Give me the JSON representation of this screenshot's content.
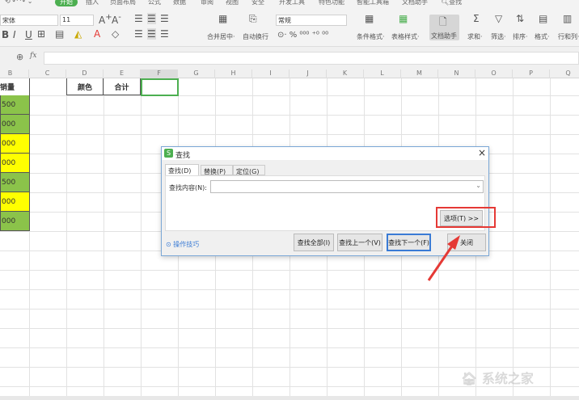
{
  "menu": {
    "items": [
      "",
      "开始",
      "插入",
      "页面布局",
      "公式",
      "数据",
      "审阅",
      "视图",
      "安全",
      "开发工具",
      "特色功能",
      "智能工具箱",
      "文档助手",
      "查找"
    ]
  },
  "ribbon": {
    "font_name": "宋体",
    "font_size": "11",
    "number_format": "常规",
    "merge": "合并居中·",
    "wrap": "自动换行",
    "cond_format": "条件格式·",
    "table_style": "表格样式·",
    "doc_helper": "文档助手",
    "sum": "求和·",
    "filter": "筛选·",
    "sort": "排序·",
    "format": "格式·",
    "rowcol": "行和列·"
  },
  "formula_bar": {
    "fx": "fx",
    "value": ""
  },
  "columns": [
    "B",
    "C",
    "D",
    "E",
    "F",
    "G",
    "H",
    "I",
    "J",
    "K",
    "L",
    "M",
    "N",
    "O",
    "P",
    "Q"
  ],
  "sheet": {
    "b_header": "销量",
    "d_header": "颜色",
    "e_header": "合计",
    "b_values": [
      {
        "v": "500",
        "color": "#8bc34a"
      },
      {
        "v": "000",
        "color": "#8bc34a"
      },
      {
        "v": "000",
        "color": "#ffff00"
      },
      {
        "v": "000",
        "color": "#ffff00"
      },
      {
        "v": "500",
        "color": "#8bc34a"
      },
      {
        "v": "000",
        "color": "#ffff00"
      },
      {
        "v": "000",
        "color": "#8bc34a"
      }
    ]
  },
  "dialog": {
    "title": "查找",
    "tabs": [
      "查找(D)",
      "替换(P)",
      "定位(G)"
    ],
    "find_label": "查找内容(N):",
    "find_value": "",
    "options": "选项(T) >>",
    "tips": "操作技巧",
    "find_all": "查找全部(I)",
    "find_prev": "查找上一个(V)",
    "find_next": "查找下一个(F)",
    "close": "关闭"
  },
  "watermark": "系统之家",
  "colors": {
    "accent": "#4caf50",
    "highlight": "#e53935"
  }
}
